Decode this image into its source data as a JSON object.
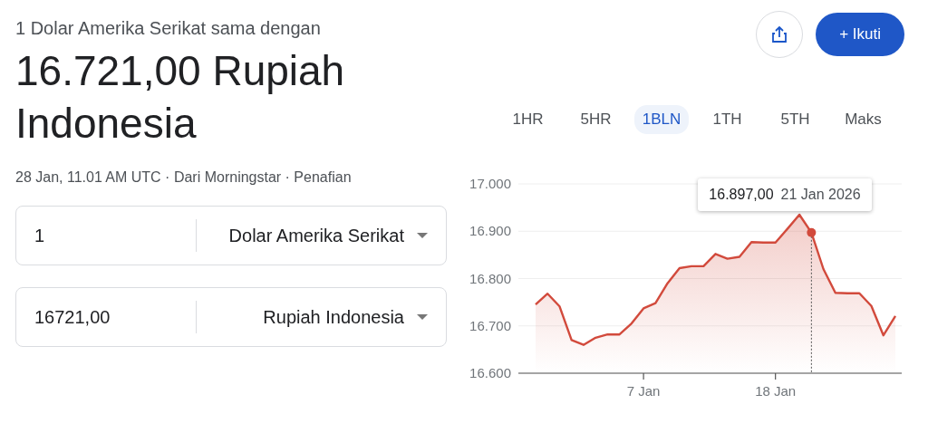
{
  "header": {
    "subtitle": "1 Dolar Amerika Serikat sama dengan",
    "result": "16.721,00 Rupiah Indonesia",
    "meta": "28 Jan, 11.01 AM UTC · Dari Morningstar · Penafian"
  },
  "actions": {
    "follow_label": "+ Ikuti"
  },
  "converter": [
    {
      "amount": "1",
      "currency": "Dolar Amerika Serikat"
    },
    {
      "amount": "16721,00",
      "currency": "Rupiah Indonesia"
    }
  ],
  "ranges": [
    {
      "label": "1HR",
      "selected": false
    },
    {
      "label": "5HR",
      "selected": false
    },
    {
      "label": "1BLN",
      "selected": true
    },
    {
      "label": "1TH",
      "selected": false
    },
    {
      "label": "5TH",
      "selected": false
    },
    {
      "label": "Maks",
      "selected": false
    }
  ],
  "chart_data": {
    "type": "area",
    "categories": [
      null,
      null,
      null,
      null,
      null,
      null,
      null,
      null,
      null,
      "7 Jan",
      null,
      null,
      null,
      null,
      null,
      null,
      null,
      null,
      null,
      null,
      "18 Jan",
      null,
      null,
      null,
      null,
      null,
      null,
      null,
      null,
      null,
      null
    ],
    "series": [
      {
        "color": "#d24a3c",
        "values": [
          16745,
          16768,
          16741,
          16670,
          16660,
          16675,
          16682,
          16682,
          16705,
          16737,
          16748,
          16790,
          16822,
          16826,
          16826,
          16852,
          16842,
          16846,
          16877,
          16876,
          16876,
          16905,
          16935,
          16897,
          16820,
          16770,
          16769,
          16769,
          16742,
          16680,
          16721
        ]
      }
    ],
    "ylim": [
      16600,
      17000
    ],
    "grid": true,
    "yticks": [
      {
        "value": 16600,
        "label": "16.600"
      },
      {
        "value": 16700,
        "label": "16.700"
      },
      {
        "value": 16800,
        "label": "16.800"
      },
      {
        "value": 16900,
        "label": "16.900"
      },
      {
        "value": 17000,
        "label": "17.000"
      }
    ],
    "annotations": [
      "16.897,00"
    ]
  },
  "tooltip": {
    "date": "21 Jan 2026"
  }
}
